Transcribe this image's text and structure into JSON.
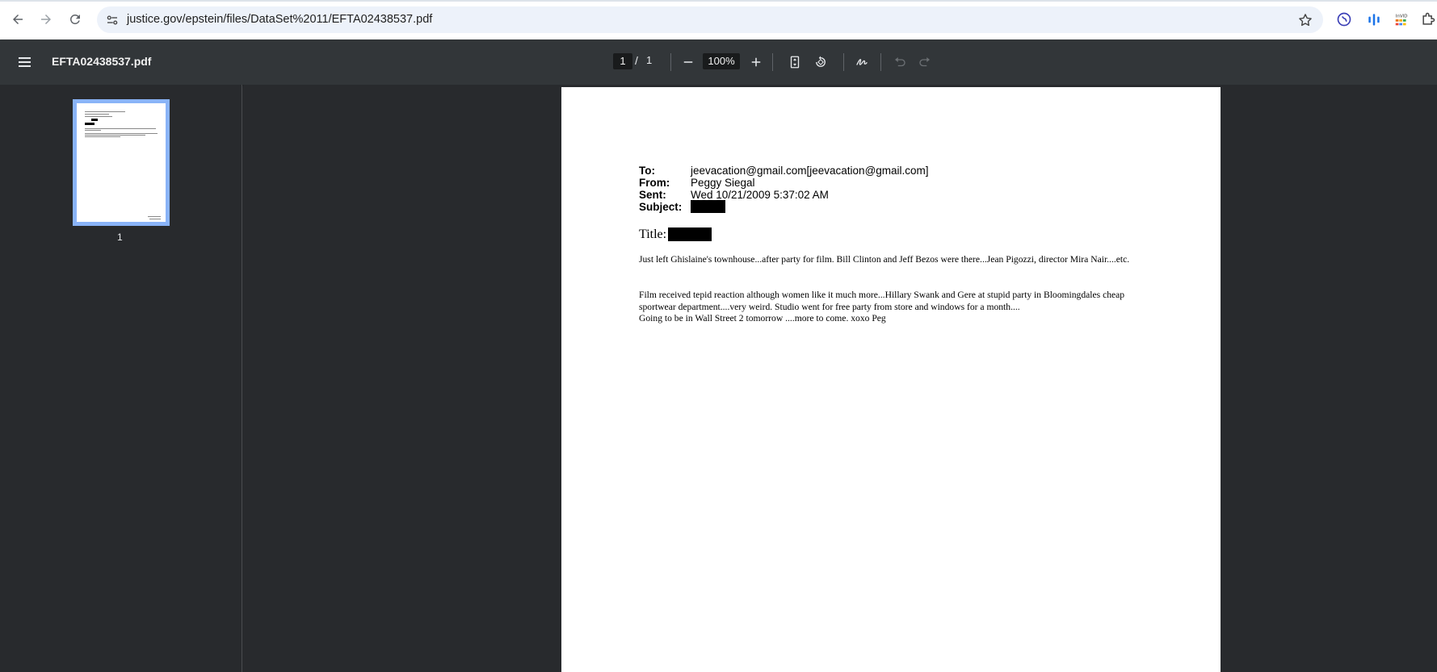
{
  "browser": {
    "url": "justice.gov/epstein/files/DataSet%2011/EFTA02438537.pdf",
    "extensions": [
      "globe-extension-icon",
      "bars-extension-icon",
      "invid-extension-icon",
      "puzzle-extensions-icon"
    ],
    "accent": "#1a73e8"
  },
  "toolbar": {
    "filename": "EFTA02438537.pdf",
    "page_current": "1",
    "page_separator": "/",
    "page_total": "1",
    "zoom": "100%"
  },
  "sidebar": {
    "thumbnails": [
      {
        "label": "1"
      }
    ]
  },
  "document": {
    "headers": [
      {
        "label": "To:",
        "value": "jeevacation@gmail.com[jeevacation@gmail.com]"
      },
      {
        "label": "From:",
        "value": "Peggy Siegal"
      },
      {
        "label": "Sent:",
        "value": "Wed 10/21/2009 5:37:02 AM"
      },
      {
        "label": "Subject:",
        "value": ""
      }
    ],
    "title_label": "Title:",
    "paragraphs": [
      "Just left Ghislaine's townhouse...after party for film.  Bill Clinton and Jeff Bezos were there...Jean Pigozzi, director Mira Nair....etc.",
      "Film received tepid reaction although women like it much more...Hillary Swank and Gere at stupid party in Bloomingdales cheap sportwear department....very weird.  Studio went for free party from store and windows for a month....",
      "Going to be in Wall Street 2 tomorrow ....more to come. xoxo Peg"
    ]
  }
}
